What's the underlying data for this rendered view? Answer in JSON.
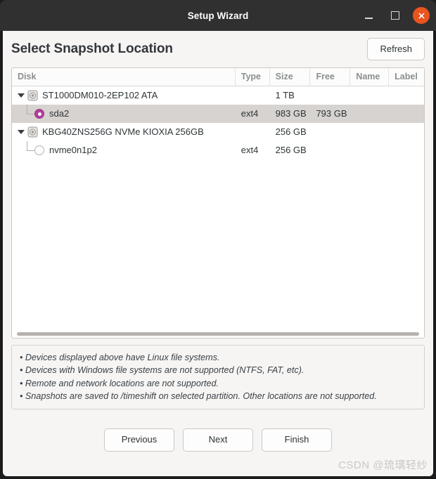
{
  "window": {
    "title": "Setup Wizard",
    "controls": {
      "minimize": "minimize-icon",
      "maximize": "maximize-icon",
      "close": "close-icon"
    }
  },
  "page": {
    "title": "Select Snapshot Location",
    "refresh_label": "Refresh"
  },
  "table": {
    "columns": [
      "Disk",
      "Type",
      "Size",
      "Free",
      "Name",
      "Label"
    ],
    "rows": [
      {
        "kind": "disk",
        "disk": "ST1000DM010-2EP102 ATA",
        "type": "",
        "size": "1 TB",
        "free": "",
        "name": "",
        "label": "",
        "selected": false,
        "expanded": true
      },
      {
        "kind": "partition",
        "disk": "sda2",
        "type": "ext4",
        "size": "983 GB",
        "free": "793 GB",
        "name": "",
        "label": "",
        "selected": true,
        "radio": "on"
      },
      {
        "kind": "disk",
        "disk": "KBG40ZNS256G NVMe KIOXIA 256GB",
        "type": "",
        "size": "256 GB",
        "free": "",
        "name": "",
        "label": "",
        "selected": false,
        "expanded": true
      },
      {
        "kind": "partition",
        "disk": "nvme0n1p2",
        "type": "ext4",
        "size": "256 GB",
        "free": "",
        "name": "",
        "label": "",
        "selected": false,
        "radio": "off"
      }
    ]
  },
  "info": {
    "line1": "• Devices displayed above have Linux file systems.",
    "line2": "• Devices with Windows file systems are not supported (NTFS, FAT, etc).",
    "line3": "• Remote and network locations are not supported.",
    "line4": "• Snapshots are saved to /timeshift on selected partition. Other locations are not supported."
  },
  "footer": {
    "previous": "Previous",
    "next": "Next",
    "finish": "Finish"
  },
  "watermark": "CSDN @琉璃轻纱",
  "colors": {
    "accent_close": "#e9541f",
    "radio_selected": "#b0409a",
    "titlebar": "#303030",
    "body_bg": "#f6f5f4",
    "selection": "#d6d3d0"
  }
}
